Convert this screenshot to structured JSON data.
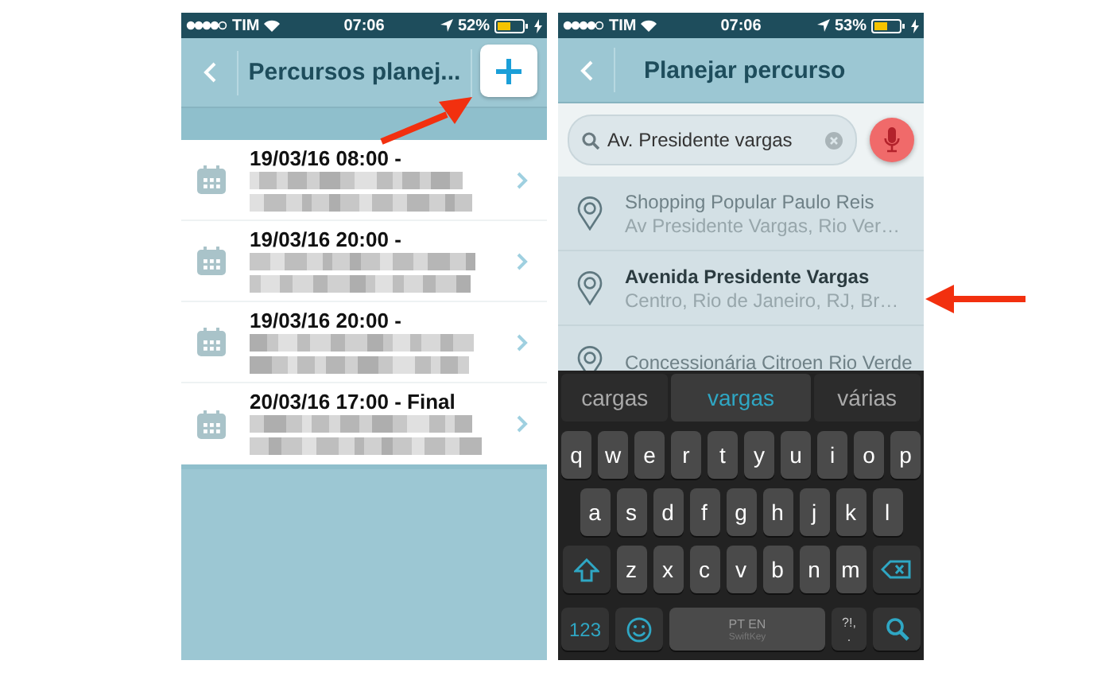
{
  "left_screen": {
    "status_bar": {
      "carrier": "TIM",
      "time": "07:06",
      "battery": "52%"
    },
    "nav": {
      "title": "Percursos planej..."
    },
    "routes": [
      {
        "title": "19/03/16 08:00 -"
      },
      {
        "title": "19/03/16 20:00 -"
      },
      {
        "title": "19/03/16 20:00 -"
      },
      {
        "title": "20/03/16 17:00 - Final"
      }
    ]
  },
  "right_screen": {
    "status_bar": {
      "carrier": "TIM",
      "time": "07:06",
      "battery": "53%"
    },
    "nav": {
      "title": "Planejar percurso"
    },
    "search": {
      "value": "Av. Presidente vargas"
    },
    "suggestions": [
      {
        "title": "Shopping Popular Paulo Reis",
        "subtitle": "Av Presidente Vargas, Rio Ver…",
        "selected": false
      },
      {
        "title": "Avenida Presidente Vargas",
        "subtitle": "Centro, Rio de Janeiro, RJ, Br…",
        "selected": true
      },
      {
        "title": "Concessionária Citroen Rio Verde",
        "selected": false
      }
    ],
    "keyboard": {
      "predictions": [
        {
          "text": "cargas",
          "selected": false
        },
        {
          "text": "vargas",
          "selected": true
        },
        {
          "text": "várias",
          "selected": false
        }
      ],
      "rows": [
        [
          "q",
          "w",
          "e",
          "r",
          "t",
          "y",
          "u",
          "i",
          "o",
          "p"
        ],
        [
          "a",
          "s",
          "d",
          "f",
          "g",
          "h",
          "j",
          "k",
          "l"
        ],
        [
          "z",
          "x",
          "c",
          "v",
          "b",
          "n",
          "m"
        ]
      ],
      "numbers_key": "123",
      "space_label": "PT EN",
      "space_brand": "SwiftKey",
      "punct_top": "?!,",
      "punct_bottom": "."
    }
  }
}
